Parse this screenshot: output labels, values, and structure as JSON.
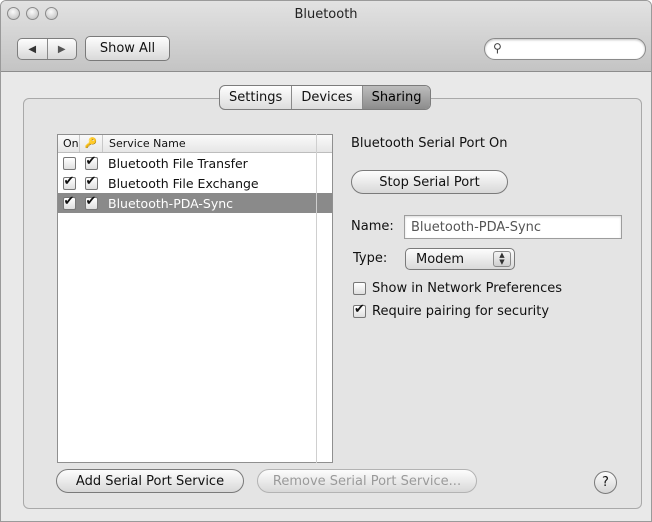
{
  "window": {
    "title": "Bluetooth"
  },
  "toolbar": {
    "back_icon": "◀",
    "forward_icon": "▶",
    "show_all_label": "Show All",
    "search_icon": "⚲",
    "search_placeholder": ""
  },
  "tabs": [
    {
      "label": "Settings",
      "active": false
    },
    {
      "label": "Devices",
      "active": false
    },
    {
      "label": "Sharing",
      "active": true
    }
  ],
  "services": {
    "headers": {
      "on": "On",
      "key_icon": "🔑",
      "name": "Service Name"
    },
    "rows": [
      {
        "name": "Bluetooth File Transfer",
        "on": false,
        "secure": true,
        "selected": false
      },
      {
        "name": "Bluetooth File Exchange",
        "on": true,
        "secure": true,
        "selected": false
      },
      {
        "name": "Bluetooth-PDA-Sync",
        "on": true,
        "secure": true,
        "selected": true
      }
    ]
  },
  "detail": {
    "status": "Bluetooth Serial Port On",
    "stop_button": "Stop Serial Port",
    "name_label": "Name:",
    "name_value": "Bluetooth-PDA-Sync",
    "type_label": "Type:",
    "type_value": "Modem",
    "show_network_label": "Show in Network Preferences",
    "show_network_checked": false,
    "require_pairing_label": "Require pairing for security",
    "require_pairing_checked": true
  },
  "footer": {
    "add_button": "Add Serial Port Service",
    "remove_button": "Remove Serial Port Service...",
    "help_label": "?"
  }
}
